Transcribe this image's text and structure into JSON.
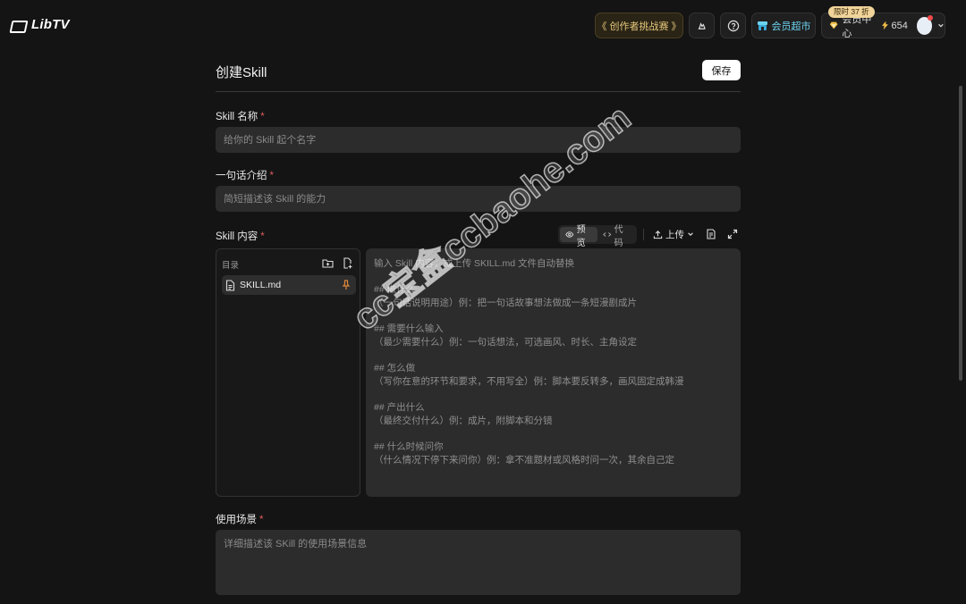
{
  "app": {
    "name": "LibTV"
  },
  "topbar": {
    "challenge_label": "《 创作者挑战赛 》",
    "vip_market_label": "会员超市",
    "sale_badge": "限时 37 折",
    "member_center_label": "会员中心",
    "credits": "654"
  },
  "form": {
    "title": "创建Skill",
    "save_label": "保存",
    "name_label": "Skill 名称",
    "name_placeholder": "给你的 Skill 起个名字",
    "intro_label": "一句话介绍",
    "intro_placeholder": "简短描述该 Skill 的能力",
    "content_label": "Skill 内容",
    "required_mark": "*",
    "preview_label": "预览",
    "code_label": "代码",
    "upload_label": "上传",
    "tree_title": "目录",
    "file_name": "SKILL.md",
    "editor_placeholder": "输入 Skill 内容，或上传 SKILL.md 文件自动替换\n\n## 做什么\n（一句话说明用途）例：把一句话故事想法做成一条短漫剧成片\n\n## 需要什么输入\n（最少需要什么）例：一句话想法，可选画风、时长、主角设定\n\n## 怎么做\n（写你在意的环节和要求，不用写全）例：脚本要反转多，画风固定成韩漫\n\n## 产出什么\n（最终交付什么）例：成片，附脚本和分镜\n\n## 什么时候问你\n（什么情况下停下来问你）例：拿不准题材或风格时问一次，其余自己定",
    "scenario_label": "使用场景",
    "scenario_placeholder": "详细描述该 SKill 的使用场景信息"
  },
  "watermark": "cc宝盒ccbaohe.com",
  "colors": {
    "accent_gold": "#e5c77a",
    "accent_cyan": "#6bd3f0",
    "required": "#e05a5a",
    "background": "#141414"
  }
}
